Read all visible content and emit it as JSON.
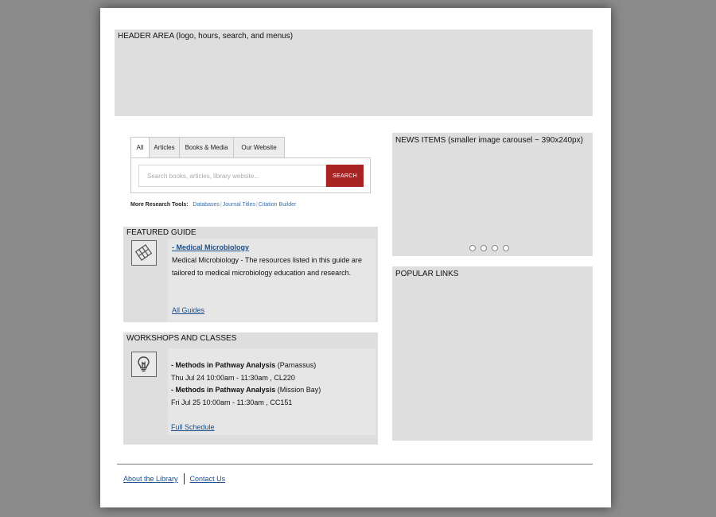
{
  "header": {
    "label": "HEADER AREA (logo, hours, search, and menus)"
  },
  "search": {
    "tabs": [
      "All",
      "Articles",
      "Books & Media",
      "Our Website"
    ],
    "active_tab": "All",
    "placeholder": "Search books, articles, library website...",
    "button_label": "SEARCH",
    "more_tools_label": "More Research Tools:",
    "tools": [
      "Databases",
      "Journal Titles",
      "Citation Builder"
    ]
  },
  "featured": {
    "label": "FEATURED GUIDE",
    "icon": "map-icon",
    "title": "- Medical Microbiology",
    "description": "Medical Microbiology - The resources listed in this guide are tailored to medical microbiology education and research.",
    "all_link": "All Guides"
  },
  "workshops": {
    "label": "WORKSHOPS AND CLASSES",
    "icon": "lightbulb-icon",
    "items": [
      {
        "title": "- Methods in Pathway Analysis",
        "location": "(Parnassus)",
        "when": "Thu Jul 24 10:00am - 11:30am , CL220"
      },
      {
        "title": "- Methods in Pathway Analysis",
        "location": "(Mission Bay)",
        "when": "Fri Jul 25 10:00am - 11:30am , CC151"
      }
    ],
    "schedule_link": "Full Schedule"
  },
  "news": {
    "label": "NEWS ITEMS (smaller image carousel ~ 390x240px)",
    "dot_count": 4
  },
  "popular": {
    "label": "POPULAR LINKS"
  },
  "footer": {
    "links": [
      "About the Library",
      "Contact Us"
    ]
  }
}
